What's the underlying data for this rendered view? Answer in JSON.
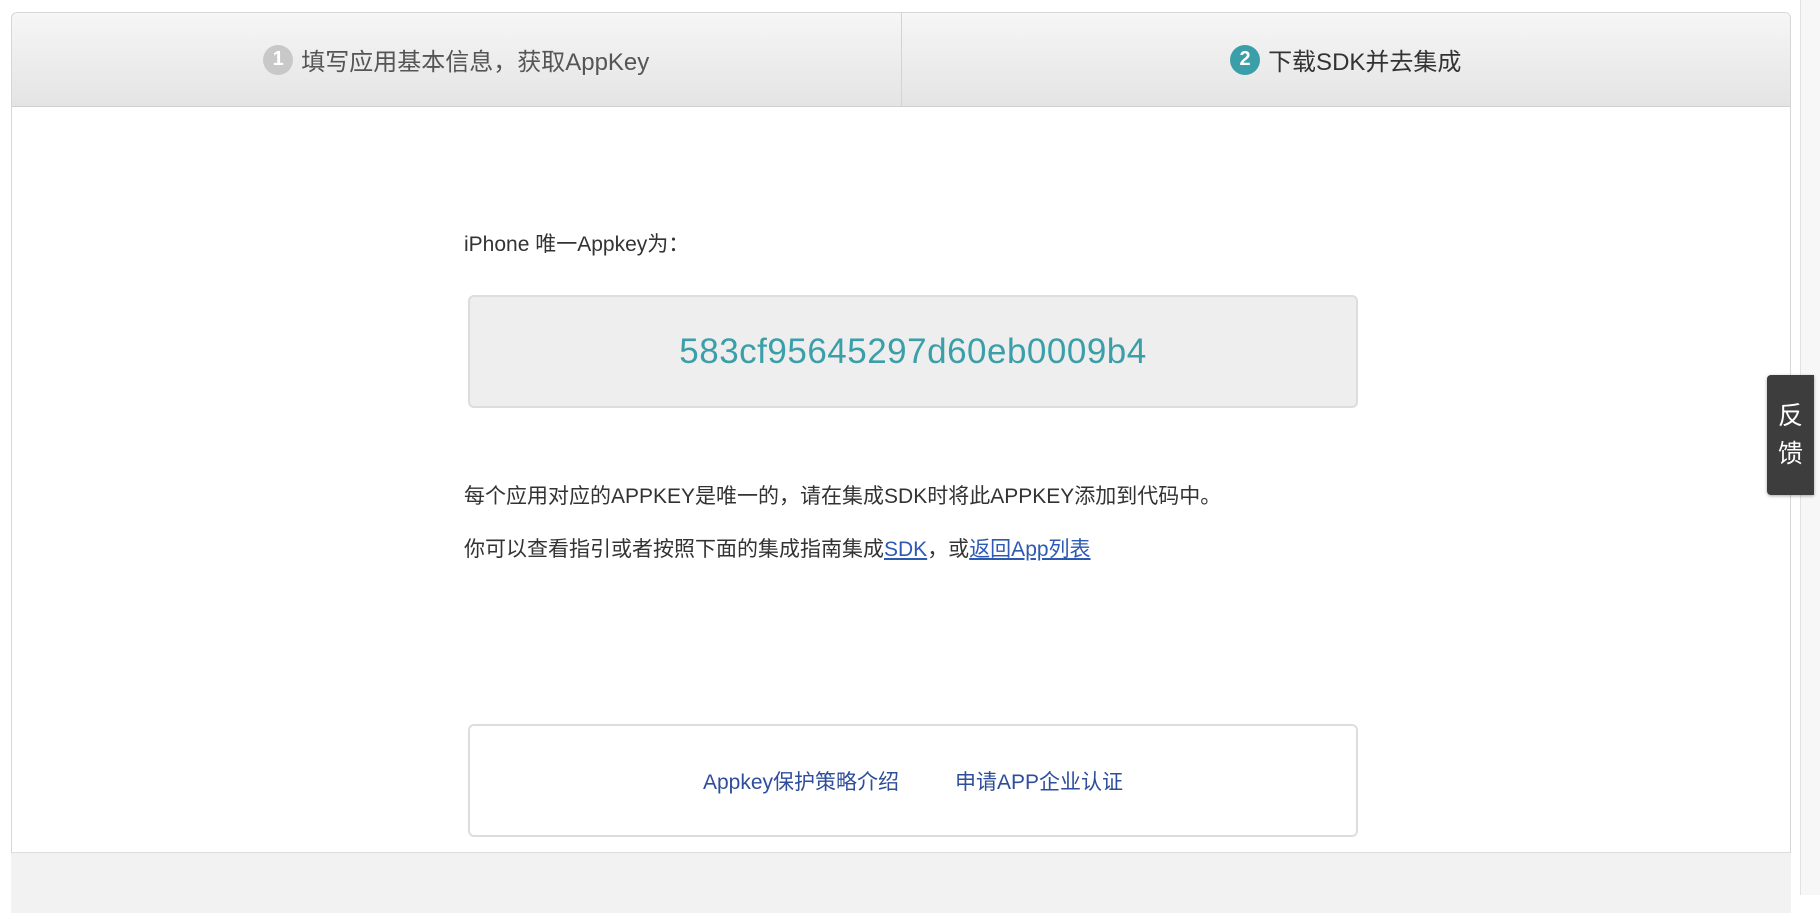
{
  "steps": [
    {
      "number": "1",
      "label": "填写应用基本信息，获取AppKey"
    },
    {
      "number": "2",
      "label": "下载SDK并去集成"
    }
  ],
  "key_section": {
    "label": "iPhone 唯一Appkey为：",
    "appkey": "583cf95645297d60eb0009b4"
  },
  "description": {
    "line1": "每个应用对应的APPKEY是唯一的，请在集成SDK时将此APPKEY添加到代码中。",
    "line2_prefix": "你可以查看指引或者按照下面的集成指南集成",
    "sdk_link": "SDK",
    "separator": "，或",
    "back_link": "返回App列表"
  },
  "links": {
    "policy": "Appkey保护策略介绍",
    "certify": "申请APP企业认证"
  },
  "feedback": {
    "char1": "反",
    "char2": "馈"
  },
  "colors": {
    "accent": "#3a9fa8",
    "link": "#2e59b3",
    "feedback_bg": "#3d3d3d"
  }
}
